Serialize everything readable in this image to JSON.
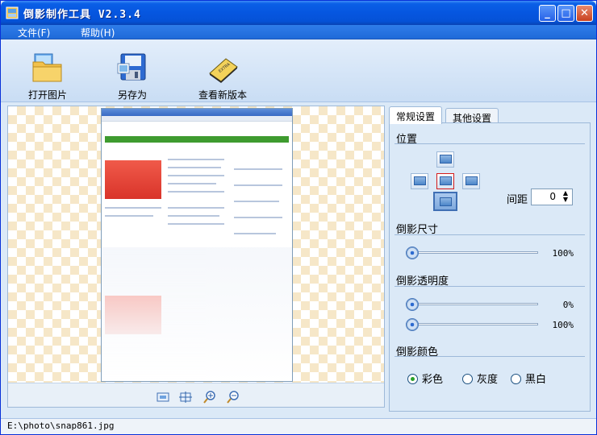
{
  "window": {
    "title": "倒影制作工具 V2.3.4"
  },
  "menu": {
    "file": "文件(F)",
    "help": "帮助(H)"
  },
  "toolbar": {
    "open_label": "打开图片",
    "saveas_label": "另存为",
    "newversion_label": "查看新版本"
  },
  "tabs": {
    "general": "常规设置",
    "other": "其他设置"
  },
  "sections": {
    "position": "位置",
    "size": "倒影尺寸",
    "opacity": "倒影透明度",
    "color": "倒影颜色"
  },
  "position": {
    "spacing_label": "间距",
    "spacing_value": "0",
    "selected": "center"
  },
  "size_slider": {
    "value": 0,
    "value_text": "100%"
  },
  "opacity_sliders": [
    {
      "value": 0,
      "value_text": "0%"
    },
    {
      "value": 0,
      "value_text": "100%"
    }
  ],
  "color": {
    "options": [
      "彩色",
      "灰度",
      "黑白"
    ],
    "selected": "彩色"
  },
  "status": {
    "path": "E:\\photo\\snap861.jpg"
  },
  "colors": {
    "accent": "#0a5fe6",
    "checker": "#f6e7c8",
    "panel": "#dbe9f7"
  }
}
